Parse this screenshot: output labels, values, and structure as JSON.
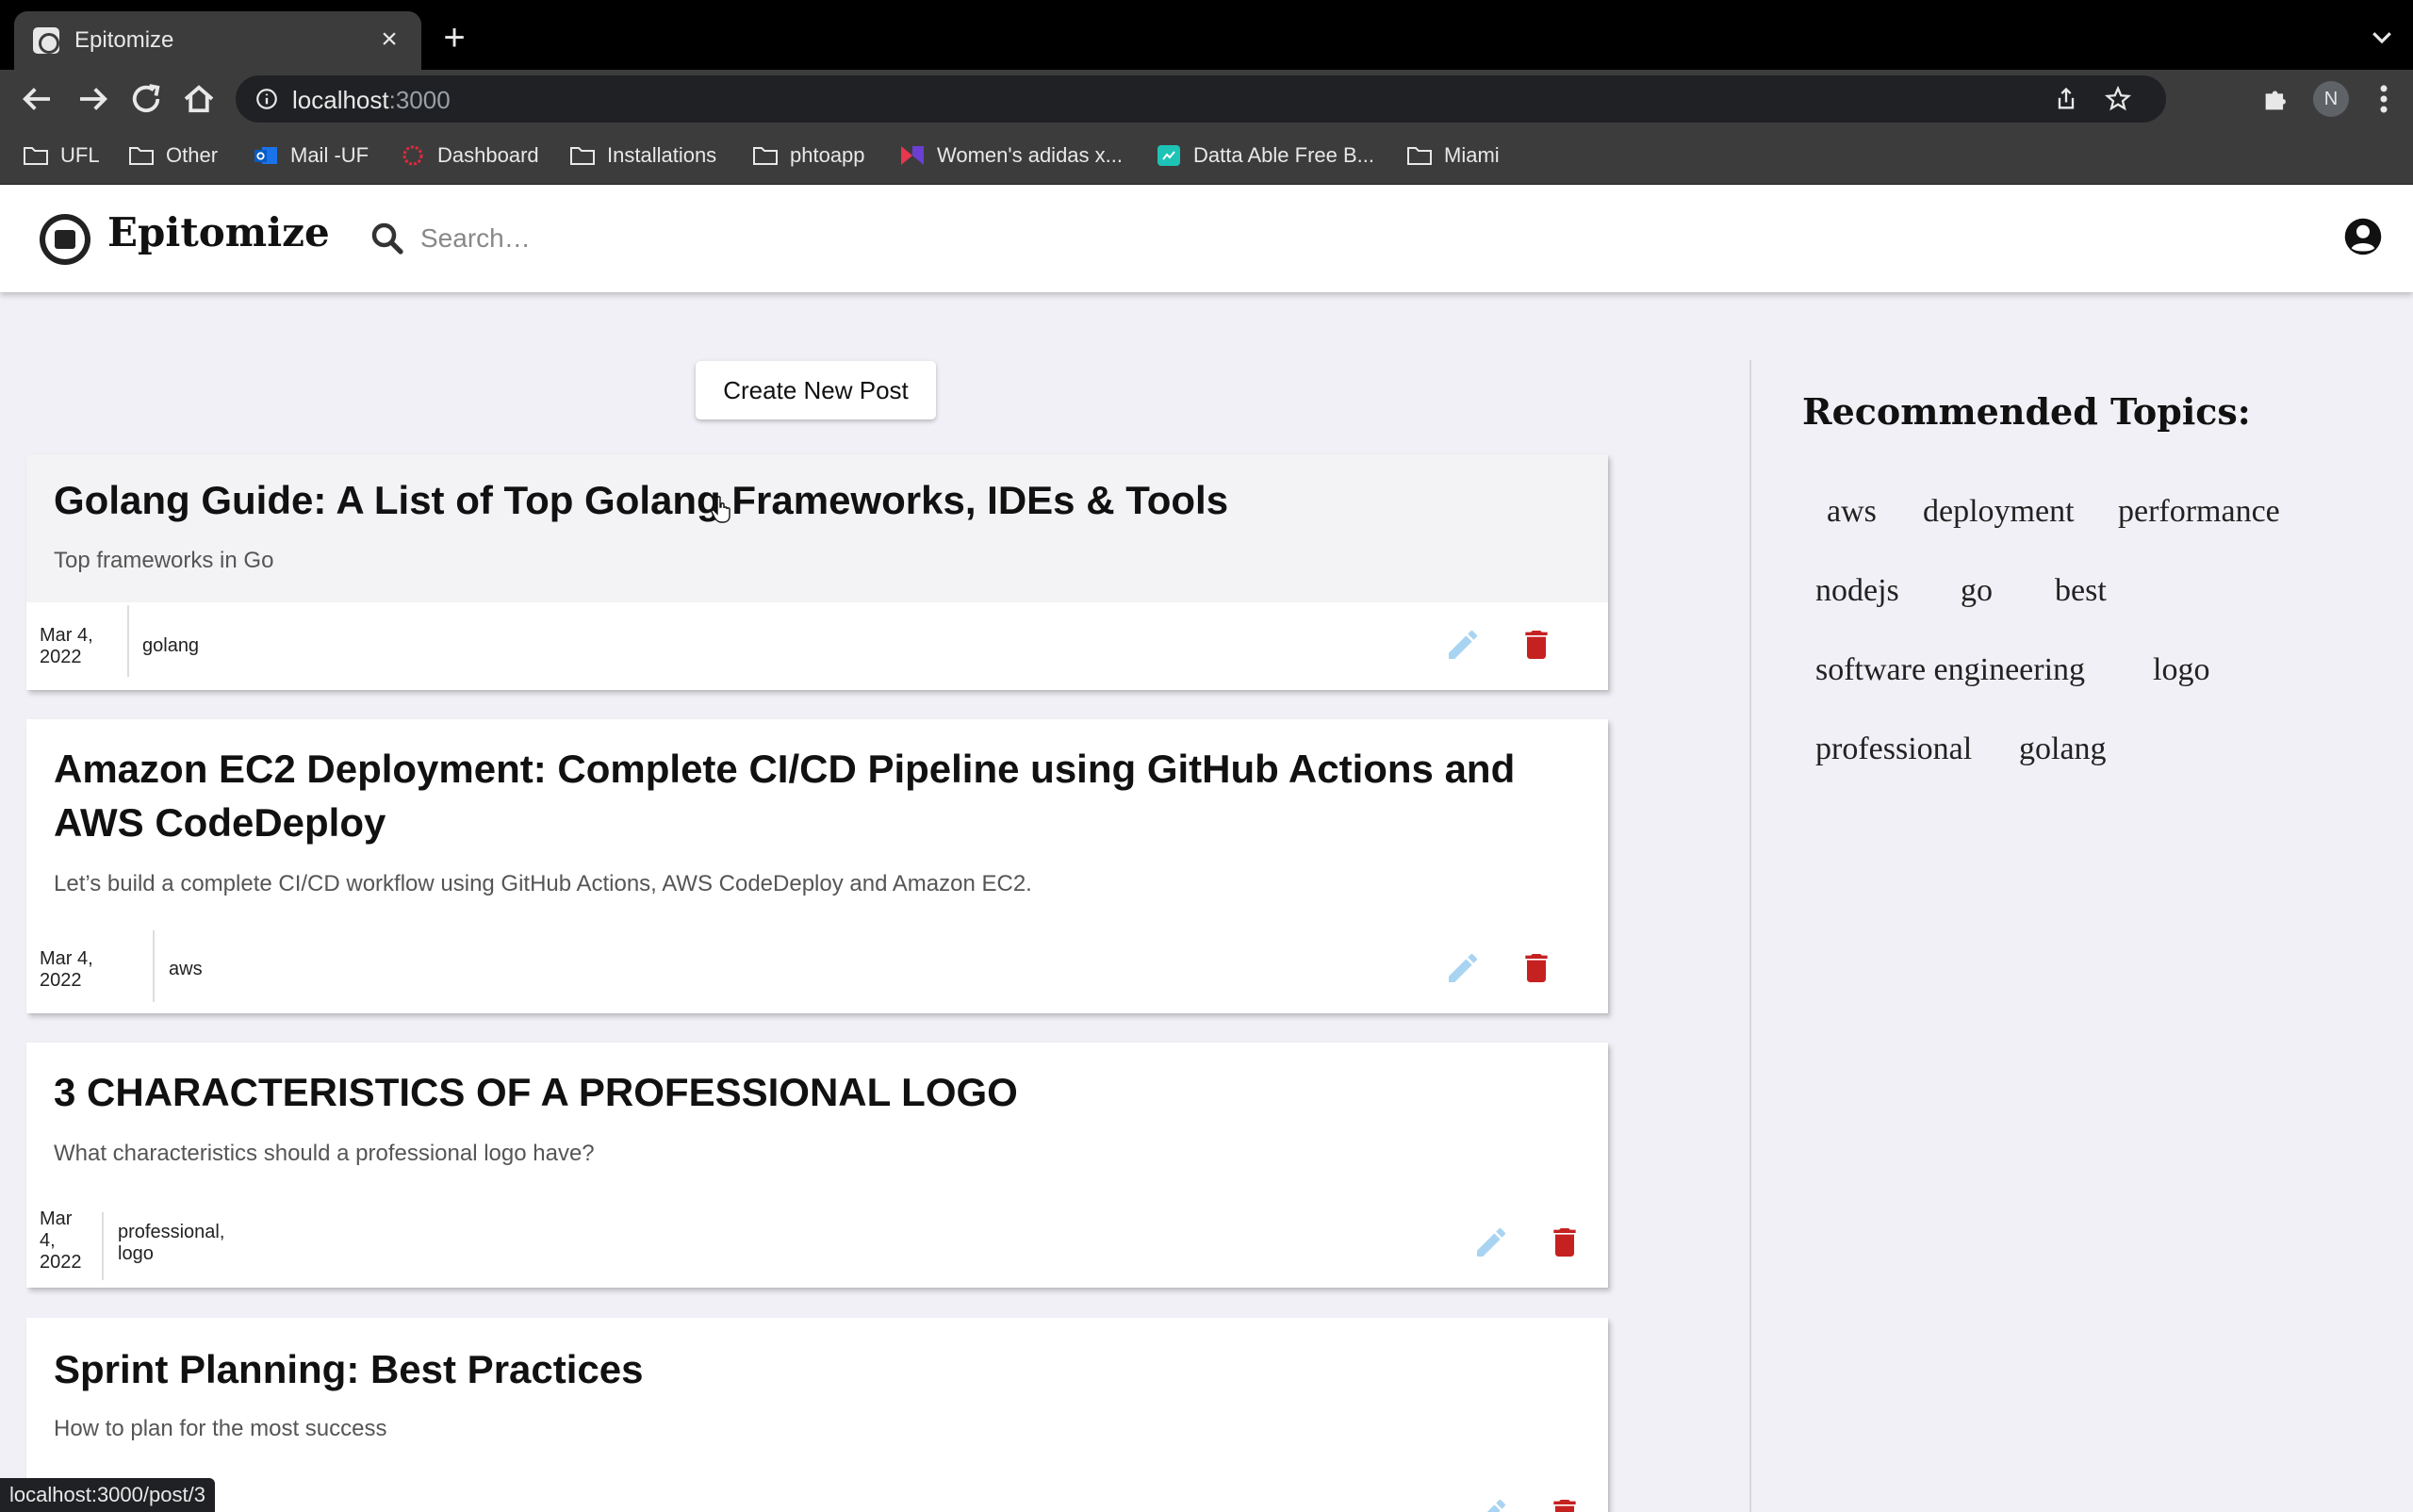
{
  "browser": {
    "tab_title": "Epitomize",
    "url_host": "localhost",
    "url_port": ":3000",
    "profile_initial": "N",
    "bookmarks": [
      {
        "label": "UFL",
        "icon": "folder-icon"
      },
      {
        "label": "Other",
        "icon": "folder-icon"
      },
      {
        "label": "Mail -UF",
        "icon": "outlook-icon"
      },
      {
        "label": "Dashboard",
        "icon": "dashboard-icon"
      },
      {
        "label": "Installations",
        "icon": "folder-icon"
      },
      {
        "label": "phtoapp",
        "icon": "folder-icon"
      },
      {
        "label": "Women's adidas x...",
        "icon": "adidas-icon"
      },
      {
        "label": "Datta Able Free B...",
        "icon": "datta-icon"
      },
      {
        "label": "Miami",
        "icon": "folder-icon"
      }
    ],
    "status_url": "localhost:3000/post/3"
  },
  "header": {
    "brand": "Epitomize",
    "search_placeholder": "Search…"
  },
  "main": {
    "create_label": "Create New Post",
    "posts": [
      {
        "title": "Golang Guide: A List of Top Golang Frameworks, IDEs & Tools",
        "description": "Top frameworks in Go",
        "date_lines": [
          "Mar 4,",
          "2022"
        ],
        "tags_lines": [
          "golang"
        ]
      },
      {
        "title": "Amazon EC2 Deployment: Complete CI/CD Pipeline using GitHub Actions and AWS CodeDeploy",
        "description": "Let’s build a complete CI/CD workflow using GitHub Actions, AWS CodeDeploy and Amazon EC2.",
        "date_lines": [
          "Mar 4,",
          "2022"
        ],
        "tags_lines": [
          "aws"
        ]
      },
      {
        "title": "3 CHARACTERISTICS OF A PROFESSIONAL LOGO",
        "description": "What characteristics should a professional logo have?",
        "date_lines": [
          "Mar",
          "4,",
          "2022"
        ],
        "tags_lines": [
          "professional,",
          "logo"
        ]
      },
      {
        "title": "Sprint Planning: Best Practices",
        "description": "How to plan for the most success",
        "date_lines": [],
        "tags_lines": []
      }
    ]
  },
  "sidebar": {
    "title": "Recommended Topics:",
    "topics": [
      "aws",
      "deployment",
      "performance",
      "nodejs",
      "go",
      "best",
      "software engineering",
      "logo",
      "professional",
      "golang"
    ]
  },
  "colors": {
    "edit": "#a8d4f2",
    "delete": "#c62121",
    "hover_card": "#f3f2f4",
    "page_bg": "#f0f0f6"
  }
}
